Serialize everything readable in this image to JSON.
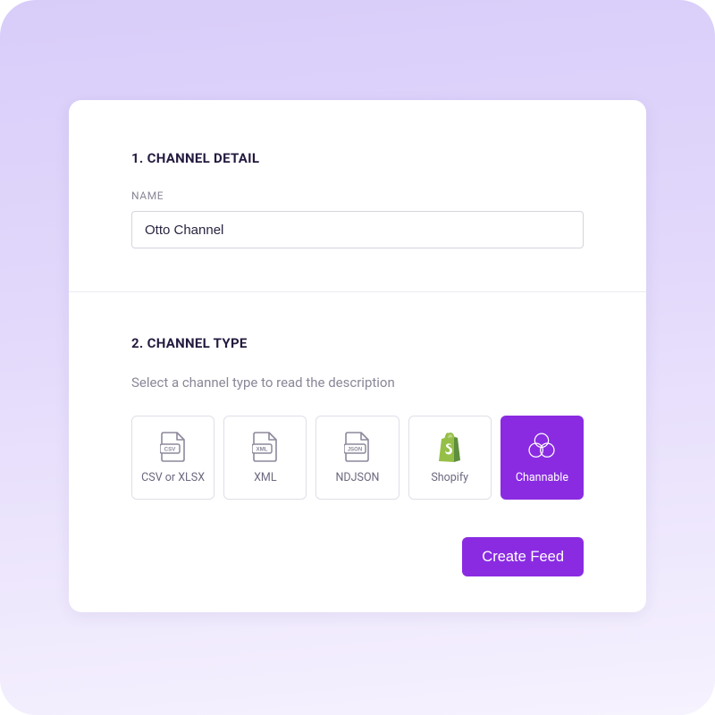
{
  "section1": {
    "heading": "1. CHANNEL DETAIL",
    "name_label": "NAME",
    "name_value": "Otto Channel"
  },
  "section2": {
    "heading": "2. CHANNEL TYPE",
    "subtext": "Select a channel type to read the description",
    "types": [
      {
        "label": "CSV or XLSX",
        "icon": "csv-file-icon",
        "selected": false
      },
      {
        "label": "XML",
        "icon": "xml-file-icon",
        "selected": false
      },
      {
        "label": "NDJSON",
        "icon": "json-file-icon",
        "selected": false
      },
      {
        "label": "Shopify",
        "icon": "shopify-icon",
        "selected": false
      },
      {
        "label": "Channable",
        "icon": "channable-icon",
        "selected": true
      }
    ],
    "create_button": "Create Feed"
  },
  "colors": {
    "accent": "#8a2be2",
    "shopify_green": "#95bf47",
    "shopify_dark": "#5e8e3e",
    "icon_gray": "#8d889c"
  }
}
